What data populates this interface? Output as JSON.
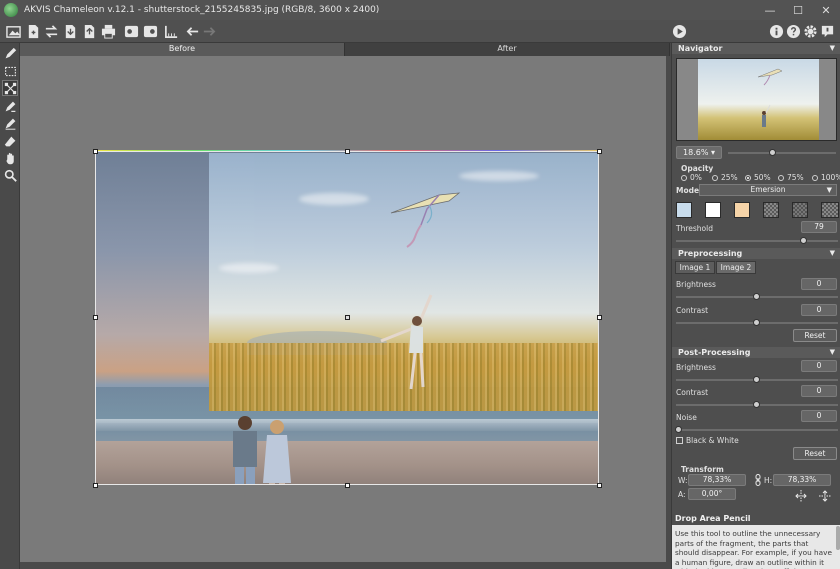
{
  "window": {
    "title": "AKVIS Chameleon v.12.1 - shutterstock_2155245835.jpg (RGB/8, 3600 x 2400)",
    "minimize": "—",
    "maximize": "☐",
    "close": "✕"
  },
  "tabs": {
    "before": "Before",
    "after": "After"
  },
  "navigator": {
    "title": "Navigator",
    "zoom": "18.6%",
    "zoom_slider": 0.42
  },
  "opacity": {
    "label": "Opacity",
    "options": [
      "0%",
      "25%",
      "50%",
      "75%",
      "100%"
    ],
    "selected": "50%"
  },
  "mode": {
    "label": "Mode",
    "value": "Emersion"
  },
  "threshold": {
    "label": "Threshold",
    "value": "79",
    "level": 0.79
  },
  "preprocessing": {
    "title": "Preprocessing",
    "tab1": "Image 1",
    "tab2": "Image 2",
    "brightness_label": "Brightness",
    "brightness": "0",
    "contrast_label": "Contrast",
    "contrast": "0",
    "reset": "Reset"
  },
  "postprocessing": {
    "title": "Post-Processing",
    "brightness_label": "Brightness",
    "brightness": "0",
    "contrast_label": "Contrast",
    "contrast": "0",
    "noise_label": "Noise",
    "noise": "0",
    "bw_label": "Black & White",
    "reset": "Reset"
  },
  "transform": {
    "title": "Transform",
    "w_label": "W:",
    "w": "78,33%",
    "h_label": "H:",
    "h": "78,33%",
    "a_label": "A:",
    "a": "0,00°"
  },
  "help": {
    "title": "Drop Area Pencil",
    "text": "Use this tool to outline the unnecessary parts of the fragment, the parts that should disappear. For example, if you have a human figure, draw an outline within it with the blue pencil and cut off the unnecessary parts with the red pencil."
  },
  "colors": {
    "swatch1": "#c8dcec",
    "swatch2": "#ffffff",
    "swatch3": "#f6d4a8"
  }
}
